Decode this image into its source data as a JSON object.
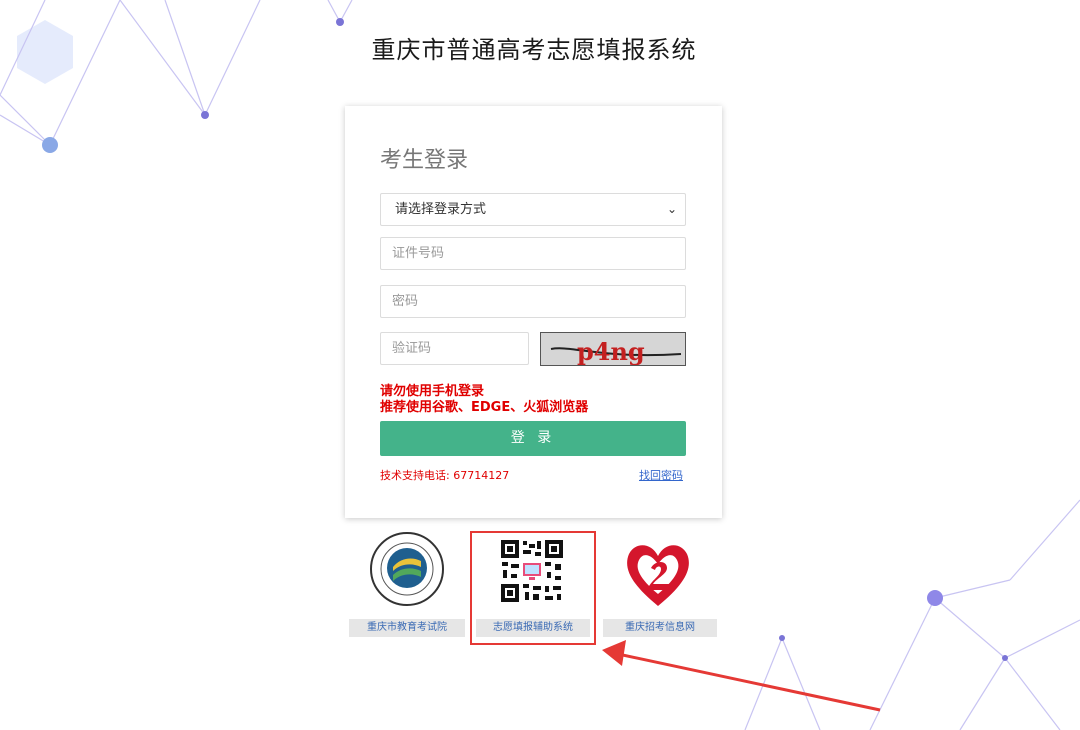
{
  "header": {
    "title": "重庆市普通高考志愿填报系统"
  },
  "login": {
    "title": "考生登录",
    "login_method_selected": "请选择登录方式",
    "id_placeholder": "证件号码",
    "password_placeholder": "密码",
    "captcha_placeholder": "验证码",
    "captcha_text": "p4ng",
    "warning_line1": "请勿使用手机登录",
    "warning_line2": "推荐使用谷歌、EDGE、火狐浏览器",
    "login_button": "登 录",
    "tech_support": "技术支持电话: 67714127",
    "forgot_password": "找回密码"
  },
  "links": [
    {
      "label": "重庆市教育考试院"
    },
    {
      "label": "志愿填报辅助系统"
    },
    {
      "label": "重庆招考信息网"
    }
  ],
  "colors": {
    "accent_green": "#44b38a",
    "warning_red": "#e00000",
    "highlight_red": "#e53935",
    "link_blue": "#3a6ab4"
  }
}
